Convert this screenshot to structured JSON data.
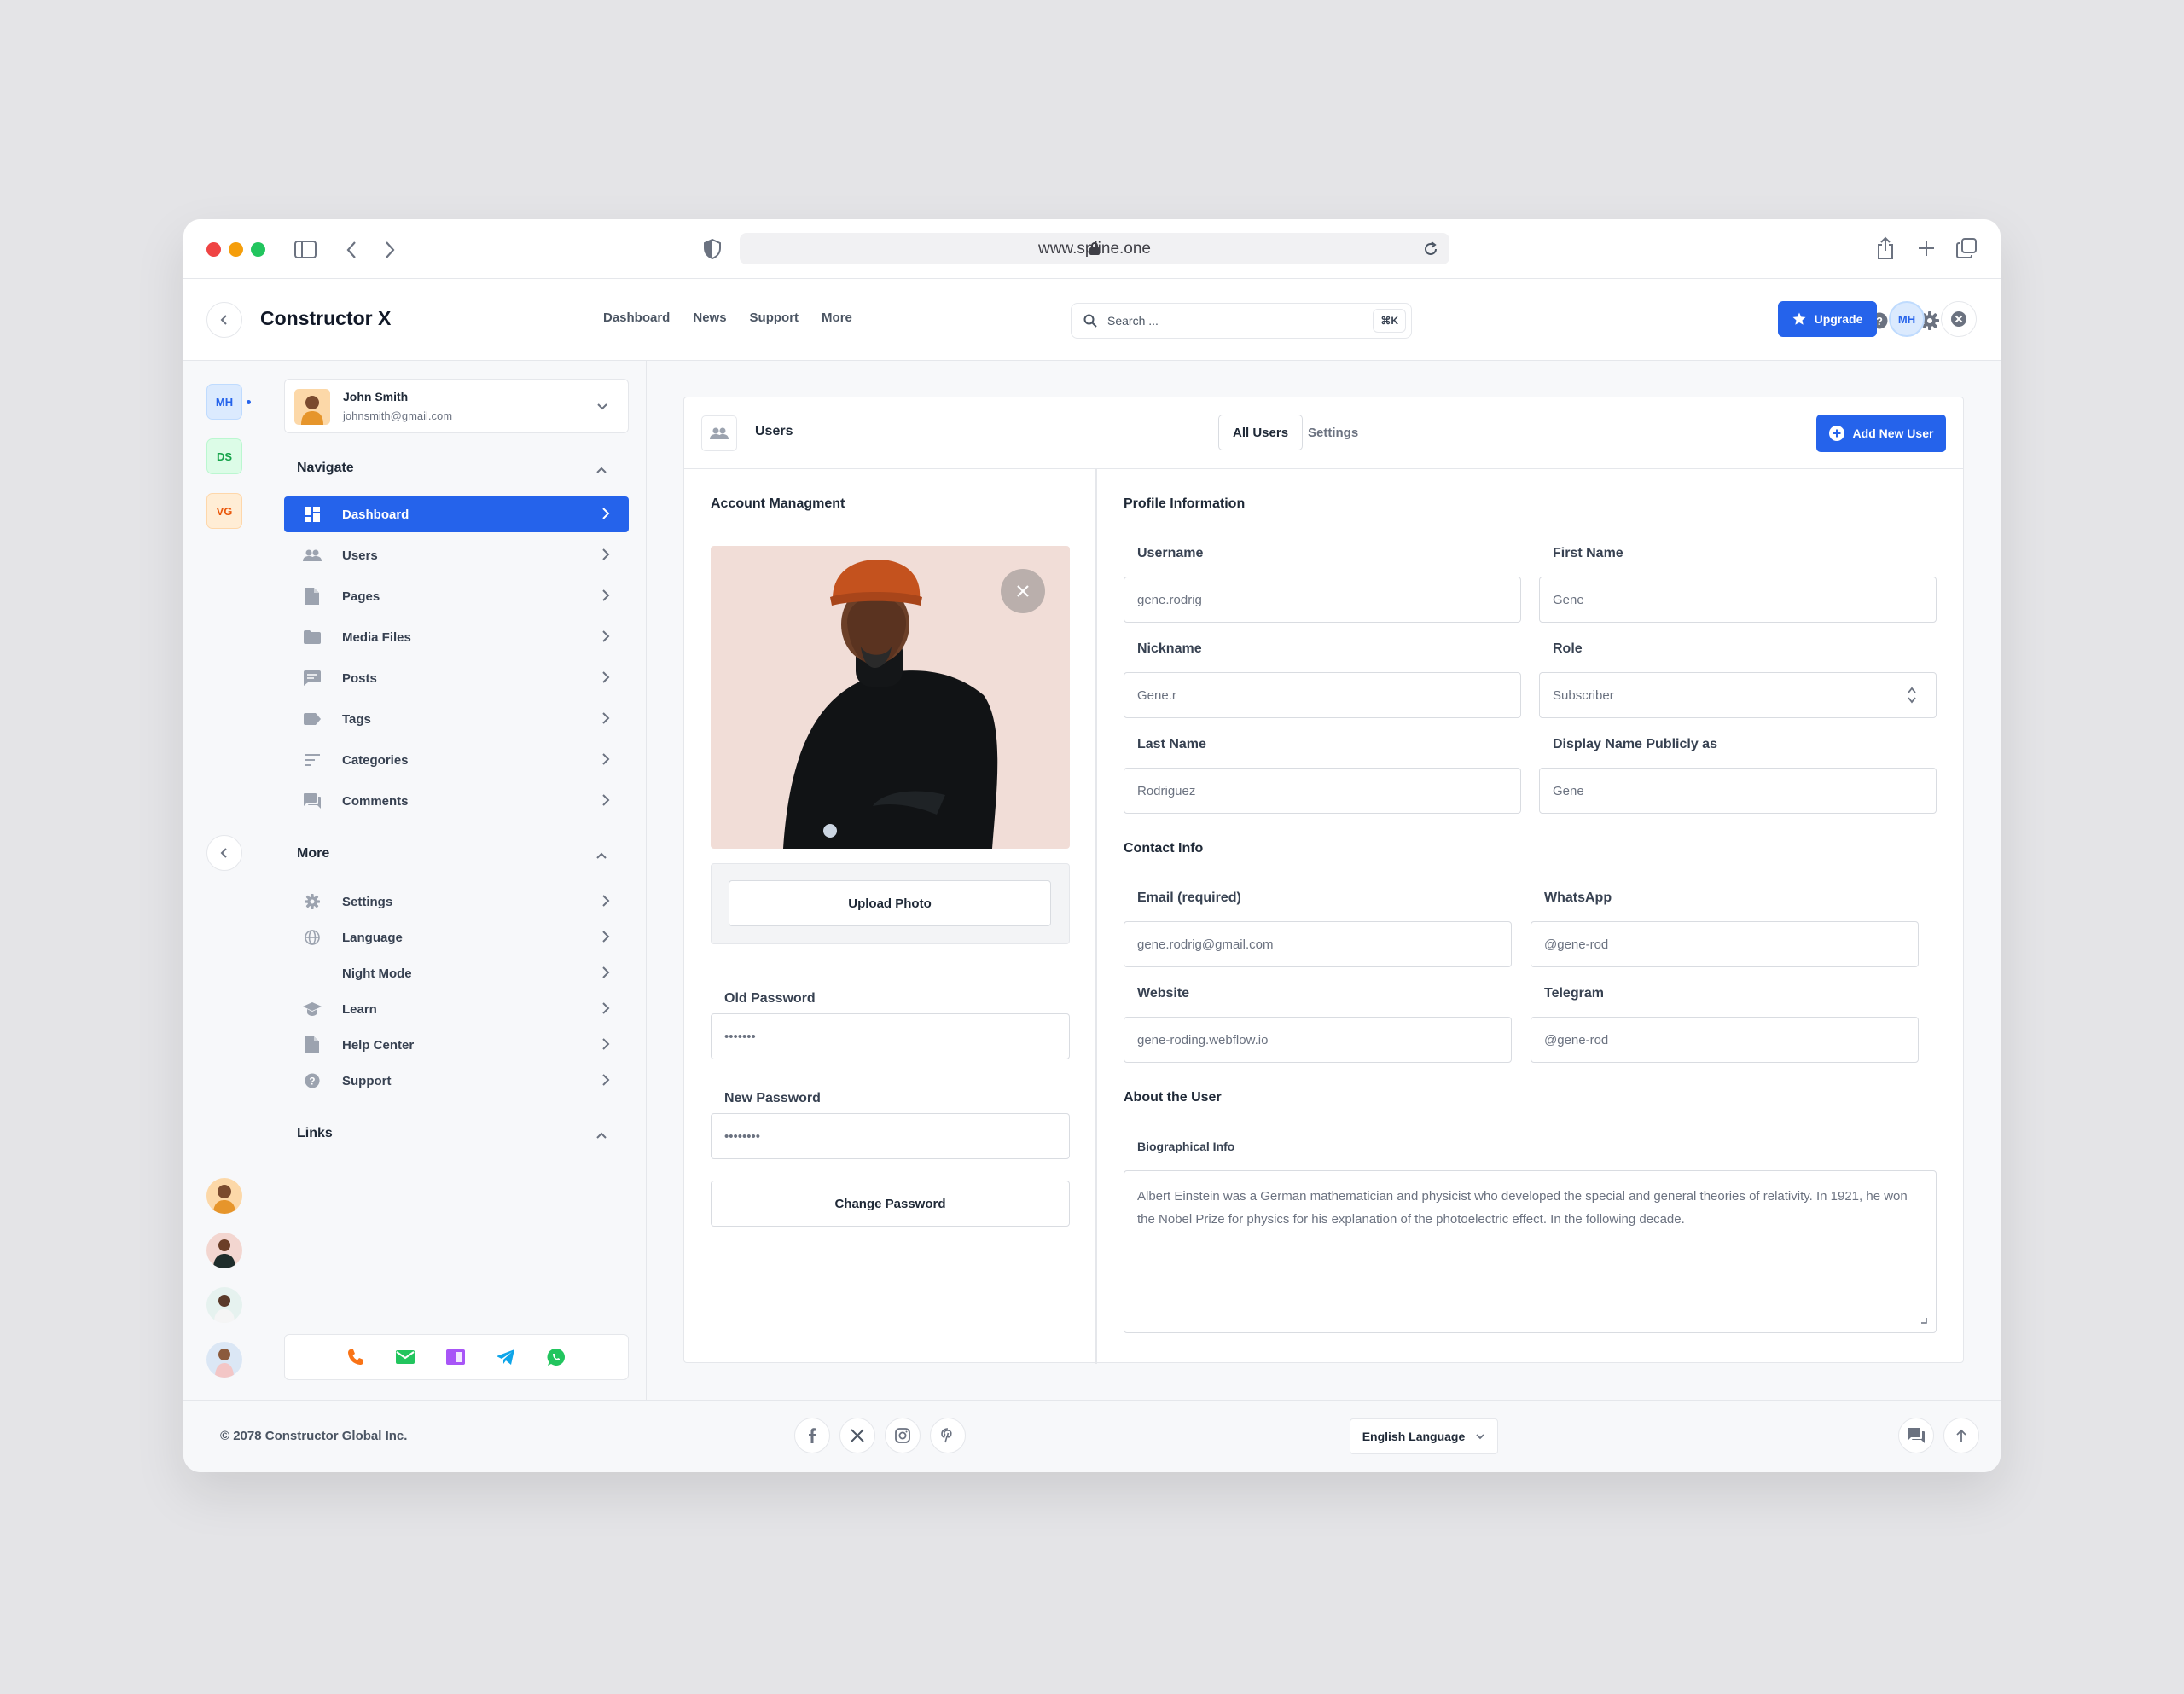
{
  "browser": {
    "url": "www.spline.one"
  },
  "header": {
    "brand": "Constructor X",
    "nav": [
      "Dashboard",
      "News",
      "Support",
      "More"
    ],
    "search_placeholder": "Search ...",
    "search_shortcut": "⌘K",
    "upgrade_label": "Upgrade",
    "avatar_initials": "MH"
  },
  "workspaces": [
    "MH",
    "DS",
    "VG"
  ],
  "user": {
    "name": "John Smith",
    "email": "johnsmith@gmail.com"
  },
  "sidebar": {
    "navigate_title": "Navigate",
    "navigate": [
      {
        "label": "Dashboard",
        "icon": "dashboard-icon"
      },
      {
        "label": "Users",
        "icon": "users-icon"
      },
      {
        "label": "Pages",
        "icon": "pages-icon"
      },
      {
        "label": "Media Files",
        "icon": "folder-icon"
      },
      {
        "label": "Posts",
        "icon": "posts-icon"
      },
      {
        "label": "Tags",
        "icon": "tag-icon"
      },
      {
        "label": "Categories",
        "icon": "categories-icon"
      },
      {
        "label": "Comments",
        "icon": "comments-icon"
      }
    ],
    "more_title": "More",
    "more": [
      {
        "label": "Settings",
        "icon": "gear-icon"
      },
      {
        "label": "Language",
        "icon": "globe-icon"
      },
      {
        "label": "Night Mode",
        "icon": "moon-icon"
      },
      {
        "label": "Learn",
        "icon": "graduation-cap-icon"
      },
      {
        "label": "Help Center",
        "icon": "document-icon"
      },
      {
        "label": "Support",
        "icon": "help-icon"
      }
    ],
    "links_title": "Links"
  },
  "panel": {
    "title": "Users",
    "tabs": [
      "All Users",
      "Settings"
    ],
    "add_button": "Add New User"
  },
  "account": {
    "title": "Account Managment",
    "upload_button": "Upload Photo",
    "old_password_label": "Old Password",
    "old_password_value": "•••••••",
    "new_password_label": "New Password",
    "new_password_value": "••••••••",
    "change_button": "Change Password"
  },
  "profile": {
    "title": "Profile Information",
    "username_label": "Username",
    "username": "gene.rodrig",
    "first_name_label": "First Name",
    "first_name": "Gene",
    "nickname_label": "Nickname",
    "nickname": "Gene.r",
    "role_label": "Role",
    "role": "Subscriber",
    "last_name_label": "Last Name",
    "last_name": "Rodriguez",
    "display_label": "Display Name Publicly as",
    "display": "Gene"
  },
  "contact": {
    "title": "Contact Info",
    "email_label": "Email (required)",
    "email": "gene.rodrig@gmail.com",
    "whatsapp_label": "WhatsApp",
    "whatsapp": "@gene-rod",
    "website_label": "Website",
    "website": "gene-roding.webflow.io",
    "telegram_label": "Telegram",
    "telegram": "@gene-rod"
  },
  "about": {
    "title": "About the User",
    "bio_label": "Biographical Info",
    "bio": "Albert Einstein was a German mathematician and physicist who developed the special and general theories of relativity. In 1921, he won the Nobel Prize for physics for his explanation of the photoelectric effect. In the following decade."
  },
  "footer": {
    "copyright": "© 2078 Constructor Global Inc.",
    "language": "English Language",
    "social": [
      "facebook-icon",
      "x-icon",
      "instagram-icon",
      "pinterest-icon"
    ]
  },
  "colors": {
    "accent": "#2563eb",
    "photo_bg": "#f1ddd7"
  }
}
